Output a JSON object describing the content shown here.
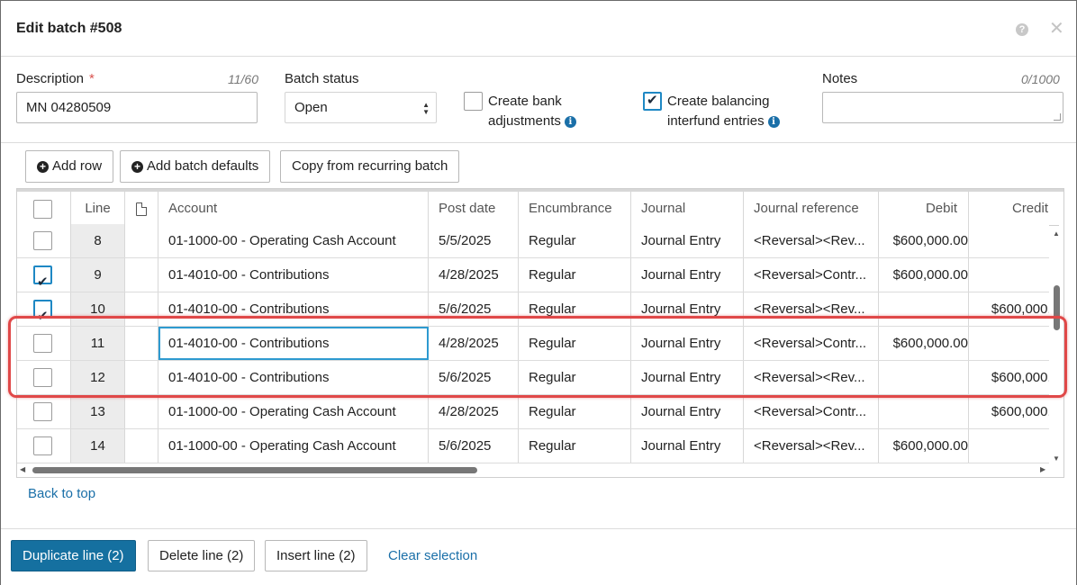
{
  "dialog": {
    "title": "Edit batch #508",
    "help_icon": "?",
    "close_icon": "✕"
  },
  "form": {
    "description_label": "Description",
    "required_mark": "*",
    "description_counter": "11/60",
    "description_value": "MN 04280509",
    "batch_status_label": "Batch status",
    "batch_status_value": "Open",
    "create_bank_adj_line1": "Create bank",
    "create_bank_adj_line2": "adjustments",
    "create_bank_adj_checked": false,
    "create_balancing_line1": "Create balancing",
    "create_balancing_line2": "interfund entries",
    "create_balancing_checked": true,
    "notes_label": "Notes",
    "notes_counter": "0/1000",
    "notes_value": ""
  },
  "toolbar": {
    "add_row": "Add row",
    "add_batch_defaults": "Add batch defaults",
    "copy_recurring": "Copy from recurring batch"
  },
  "grid": {
    "headers": {
      "line": "Line",
      "account": "Account",
      "post_date": "Post date",
      "encumbrance": "Encumbrance",
      "journal": "Journal",
      "journal_reference": "Journal reference",
      "debit": "Debit",
      "credit": "Credit"
    },
    "rows": [
      {
        "checked": false,
        "line": "8",
        "account": "01-1000-00 - Operating Cash Account",
        "post_date": "5/5/2025",
        "encumbrance": "Regular",
        "journal": "Journal Entry",
        "reference": "<Reversal><Rev...",
        "debit": "$600,000.00",
        "credit": ""
      },
      {
        "checked": true,
        "line": "9",
        "account": "01-4010-00 - Contributions",
        "post_date": "4/28/2025",
        "encumbrance": "Regular",
        "journal": "Journal Entry",
        "reference": "<Reversal>Contr...",
        "debit": "$600,000.00",
        "credit": ""
      },
      {
        "checked": true,
        "line": "10",
        "account": "01-4010-00 - Contributions",
        "post_date": "5/6/2025",
        "encumbrance": "Regular",
        "journal": "Journal Entry",
        "reference": "<Reversal><Rev...",
        "debit": "",
        "credit": "$600,000.0"
      },
      {
        "checked": false,
        "line": "11",
        "account": "01-4010-00 - Contributions",
        "post_date": "4/28/2025",
        "encumbrance": "Regular",
        "journal": "Journal Entry",
        "reference": "<Reversal>Contr...",
        "debit": "$600,000.00",
        "credit": ""
      },
      {
        "checked": false,
        "line": "12",
        "account": "01-4010-00 - Contributions",
        "post_date": "5/6/2025",
        "encumbrance": "Regular",
        "journal": "Journal Entry",
        "reference": "<Reversal><Rev...",
        "debit": "",
        "credit": "$600,000.0"
      },
      {
        "checked": false,
        "line": "13",
        "account": "01-1000-00 - Operating Cash Account",
        "post_date": "4/28/2025",
        "encumbrance": "Regular",
        "journal": "Journal Entry",
        "reference": "<Reversal>Contr...",
        "debit": "",
        "credit": "$600,000.0"
      },
      {
        "checked": false,
        "line": "14",
        "account": "01-1000-00 - Operating Cash Account",
        "post_date": "5/6/2025",
        "encumbrance": "Regular",
        "journal": "Journal Entry",
        "reference": "<Reversal><Rev...",
        "debit": "$600,000.00",
        "credit": ""
      }
    ]
  },
  "back_to_top": "Back to top",
  "footer": {
    "duplicate": "Duplicate line (2)",
    "delete": "Delete line (2)",
    "insert": "Insert line (2)",
    "clear": "Clear selection"
  },
  "colors": {
    "primary": "#1570a0",
    "link": "#1a6fa8",
    "highlight": "#e04848",
    "checkbox_border": "#1e88c4"
  }
}
